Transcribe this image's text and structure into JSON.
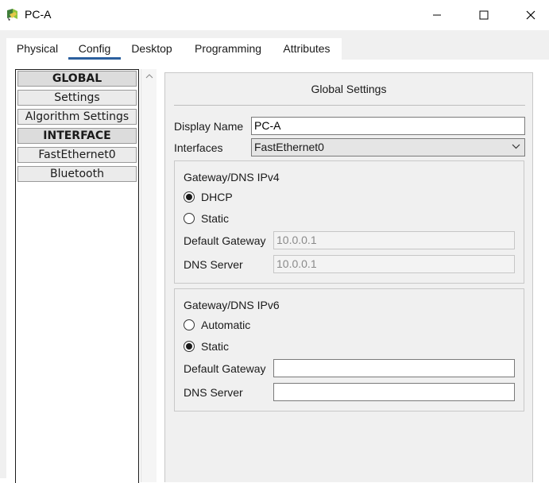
{
  "window": {
    "title": "PC-A",
    "controls": [
      "minimize",
      "maximize",
      "close"
    ]
  },
  "tabs": [
    {
      "label": "Physical",
      "active": false
    },
    {
      "label": "Config",
      "active": true
    },
    {
      "label": "Desktop",
      "active": false
    },
    {
      "label": "Programming",
      "active": false
    },
    {
      "label": "Attributes",
      "active": false
    }
  ],
  "sidebar": {
    "items": [
      {
        "label": "GLOBAL",
        "type": "header"
      },
      {
        "label": "Settings",
        "type": "item"
      },
      {
        "label": "Algorithm Settings",
        "type": "item"
      },
      {
        "label": "INTERFACE",
        "type": "header"
      },
      {
        "label": "FastEthernet0",
        "type": "item"
      },
      {
        "label": "Bluetooth",
        "type": "item"
      }
    ]
  },
  "global_settings": {
    "title": "Global Settings",
    "display_name_label": "Display Name",
    "display_name_value": "PC-A",
    "interfaces_label": "Interfaces",
    "interfaces_value": "FastEthernet0",
    "ipv4": {
      "group_title": "Gateway/DNS IPv4",
      "option_dhcp": "DHCP",
      "option_static": "Static",
      "selected": "DHCP",
      "gateway_label": "Default Gateway",
      "gateway_value": "10.0.0.1",
      "dns_label": "DNS Server",
      "dns_value": "10.0.0.1"
    },
    "ipv6": {
      "group_title": "Gateway/DNS IPv6",
      "option_automatic": "Automatic",
      "option_static": "Static",
      "selected": "Static",
      "gateway_label": "Default Gateway",
      "gateway_value": "",
      "dns_label": "DNS Server",
      "dns_value": ""
    }
  },
  "colors": {
    "tab_underline": "#2b5f9e",
    "panel_background": "#f0f0f0"
  }
}
